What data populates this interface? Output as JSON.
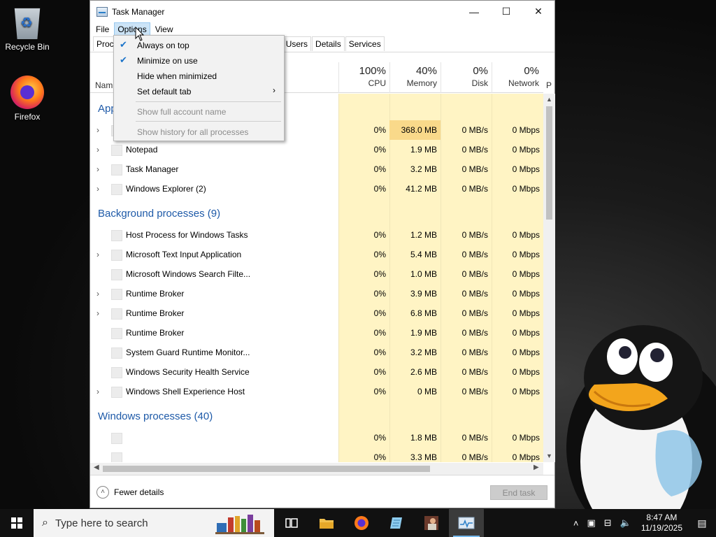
{
  "desktop": {
    "icons": [
      {
        "label": "Recycle Bin",
        "icon": "recycle-bin-icon"
      },
      {
        "label": "Firefox",
        "icon": "firefox-icon"
      }
    ]
  },
  "window": {
    "title": "Task Manager",
    "controls": {
      "minimize": "—",
      "maximize": "☐",
      "close": "✕"
    }
  },
  "menubar": {
    "file": "File",
    "options": "Options",
    "view": "View"
  },
  "tabs": [
    "Proc",
    "Users",
    "Details",
    "Services"
  ],
  "options_menu": {
    "always_on_top": {
      "label": "Always on top",
      "checked": true
    },
    "minimize_on_use": {
      "label": "Minimize on use",
      "checked": true
    },
    "hide_when_minimized": {
      "label": "Hide when minimized",
      "checked": false
    },
    "set_default_tab": {
      "label": "Set default tab",
      "submenu": "›"
    },
    "show_full_account_name": {
      "label": "Show full account name",
      "disabled": true
    },
    "show_history": {
      "label": "Show history for all processes",
      "disabled": true
    }
  },
  "columns": {
    "name": "Nam",
    "cpu": {
      "pct": "100%",
      "label": "CPU"
    },
    "memory": {
      "pct": "40%",
      "label": "Memory"
    },
    "disk": {
      "pct": "0%",
      "label": "Disk"
    },
    "network": {
      "pct": "0%",
      "label": "Network"
    },
    "power": "P"
  },
  "groups": {
    "apps": "App",
    "background": "Background processes (9)",
    "windows": "Windows processes (40)"
  },
  "rows": [
    {
      "name": "",
      "expand": true,
      "cpu": "0%",
      "memory": "368.0 MB",
      "disk": "0 MB/s",
      "network": "0 Mbps",
      "hot": true
    },
    {
      "name": "Notepad",
      "expand": true,
      "cpu": "0%",
      "memory": "1.9 MB",
      "disk": "0 MB/s",
      "network": "0 Mbps"
    },
    {
      "name": "Task Manager",
      "expand": true,
      "cpu": "0%",
      "memory": "3.2 MB",
      "disk": "0 MB/s",
      "network": "0 Mbps"
    },
    {
      "name": "Windows Explorer (2)",
      "expand": true,
      "cpu": "0%",
      "memory": "41.2 MB",
      "disk": "0 MB/s",
      "network": "0 Mbps"
    },
    {
      "name": "Host Process for Windows Tasks",
      "expand": false,
      "cpu": "0%",
      "memory": "1.2 MB",
      "disk": "0 MB/s",
      "network": "0 Mbps"
    },
    {
      "name": "Microsoft Text Input Application",
      "expand": true,
      "cpu": "0%",
      "memory": "5.4 MB",
      "disk": "0 MB/s",
      "network": "0 Mbps"
    },
    {
      "name": "Microsoft Windows Search Filte...",
      "expand": false,
      "cpu": "0%",
      "memory": "1.0 MB",
      "disk": "0 MB/s",
      "network": "0 Mbps"
    },
    {
      "name": "Runtime Broker",
      "expand": true,
      "cpu": "0%",
      "memory": "3.9 MB",
      "disk": "0 MB/s",
      "network": "0 Mbps"
    },
    {
      "name": "Runtime Broker",
      "expand": true,
      "cpu": "0%",
      "memory": "6.8 MB",
      "disk": "0 MB/s",
      "network": "0 Mbps"
    },
    {
      "name": "Runtime Broker",
      "expand": false,
      "cpu": "0%",
      "memory": "1.9 MB",
      "disk": "0 MB/s",
      "network": "0 Mbps"
    },
    {
      "name": "System Guard Runtime Monitor...",
      "expand": false,
      "cpu": "0%",
      "memory": "3.2 MB",
      "disk": "0 MB/s",
      "network": "0 Mbps"
    },
    {
      "name": "Windows Security Health Service",
      "expand": false,
      "cpu": "0%",
      "memory": "2.6 MB",
      "disk": "0 MB/s",
      "network": "0 Mbps"
    },
    {
      "name": "Windows Shell Experience Host",
      "expand": true,
      "cpu": "0%",
      "memory": "0 MB",
      "disk": "0 MB/s",
      "network": "0 Mbps"
    },
    {
      "name": "",
      "expand": false,
      "cpu": "0%",
      "memory": "1.8 MB",
      "disk": "0 MB/s",
      "network": "0 Mbps"
    },
    {
      "name": "",
      "expand": false,
      "cpu": "0%",
      "memory": "3.3 MB",
      "disk": "0 MB/s",
      "network": "0 Mbps"
    }
  ],
  "footer": {
    "fewer_details": "Fewer details",
    "end_task": "End task"
  },
  "taskbar": {
    "search_placeholder": "Type here to search",
    "time": "8:47 AM",
    "date": "11/19/2025"
  },
  "colors": {
    "accent": "#1e5aa8",
    "cpu_fill": "#fff4c4",
    "memory_hot": "#f9d98a"
  }
}
